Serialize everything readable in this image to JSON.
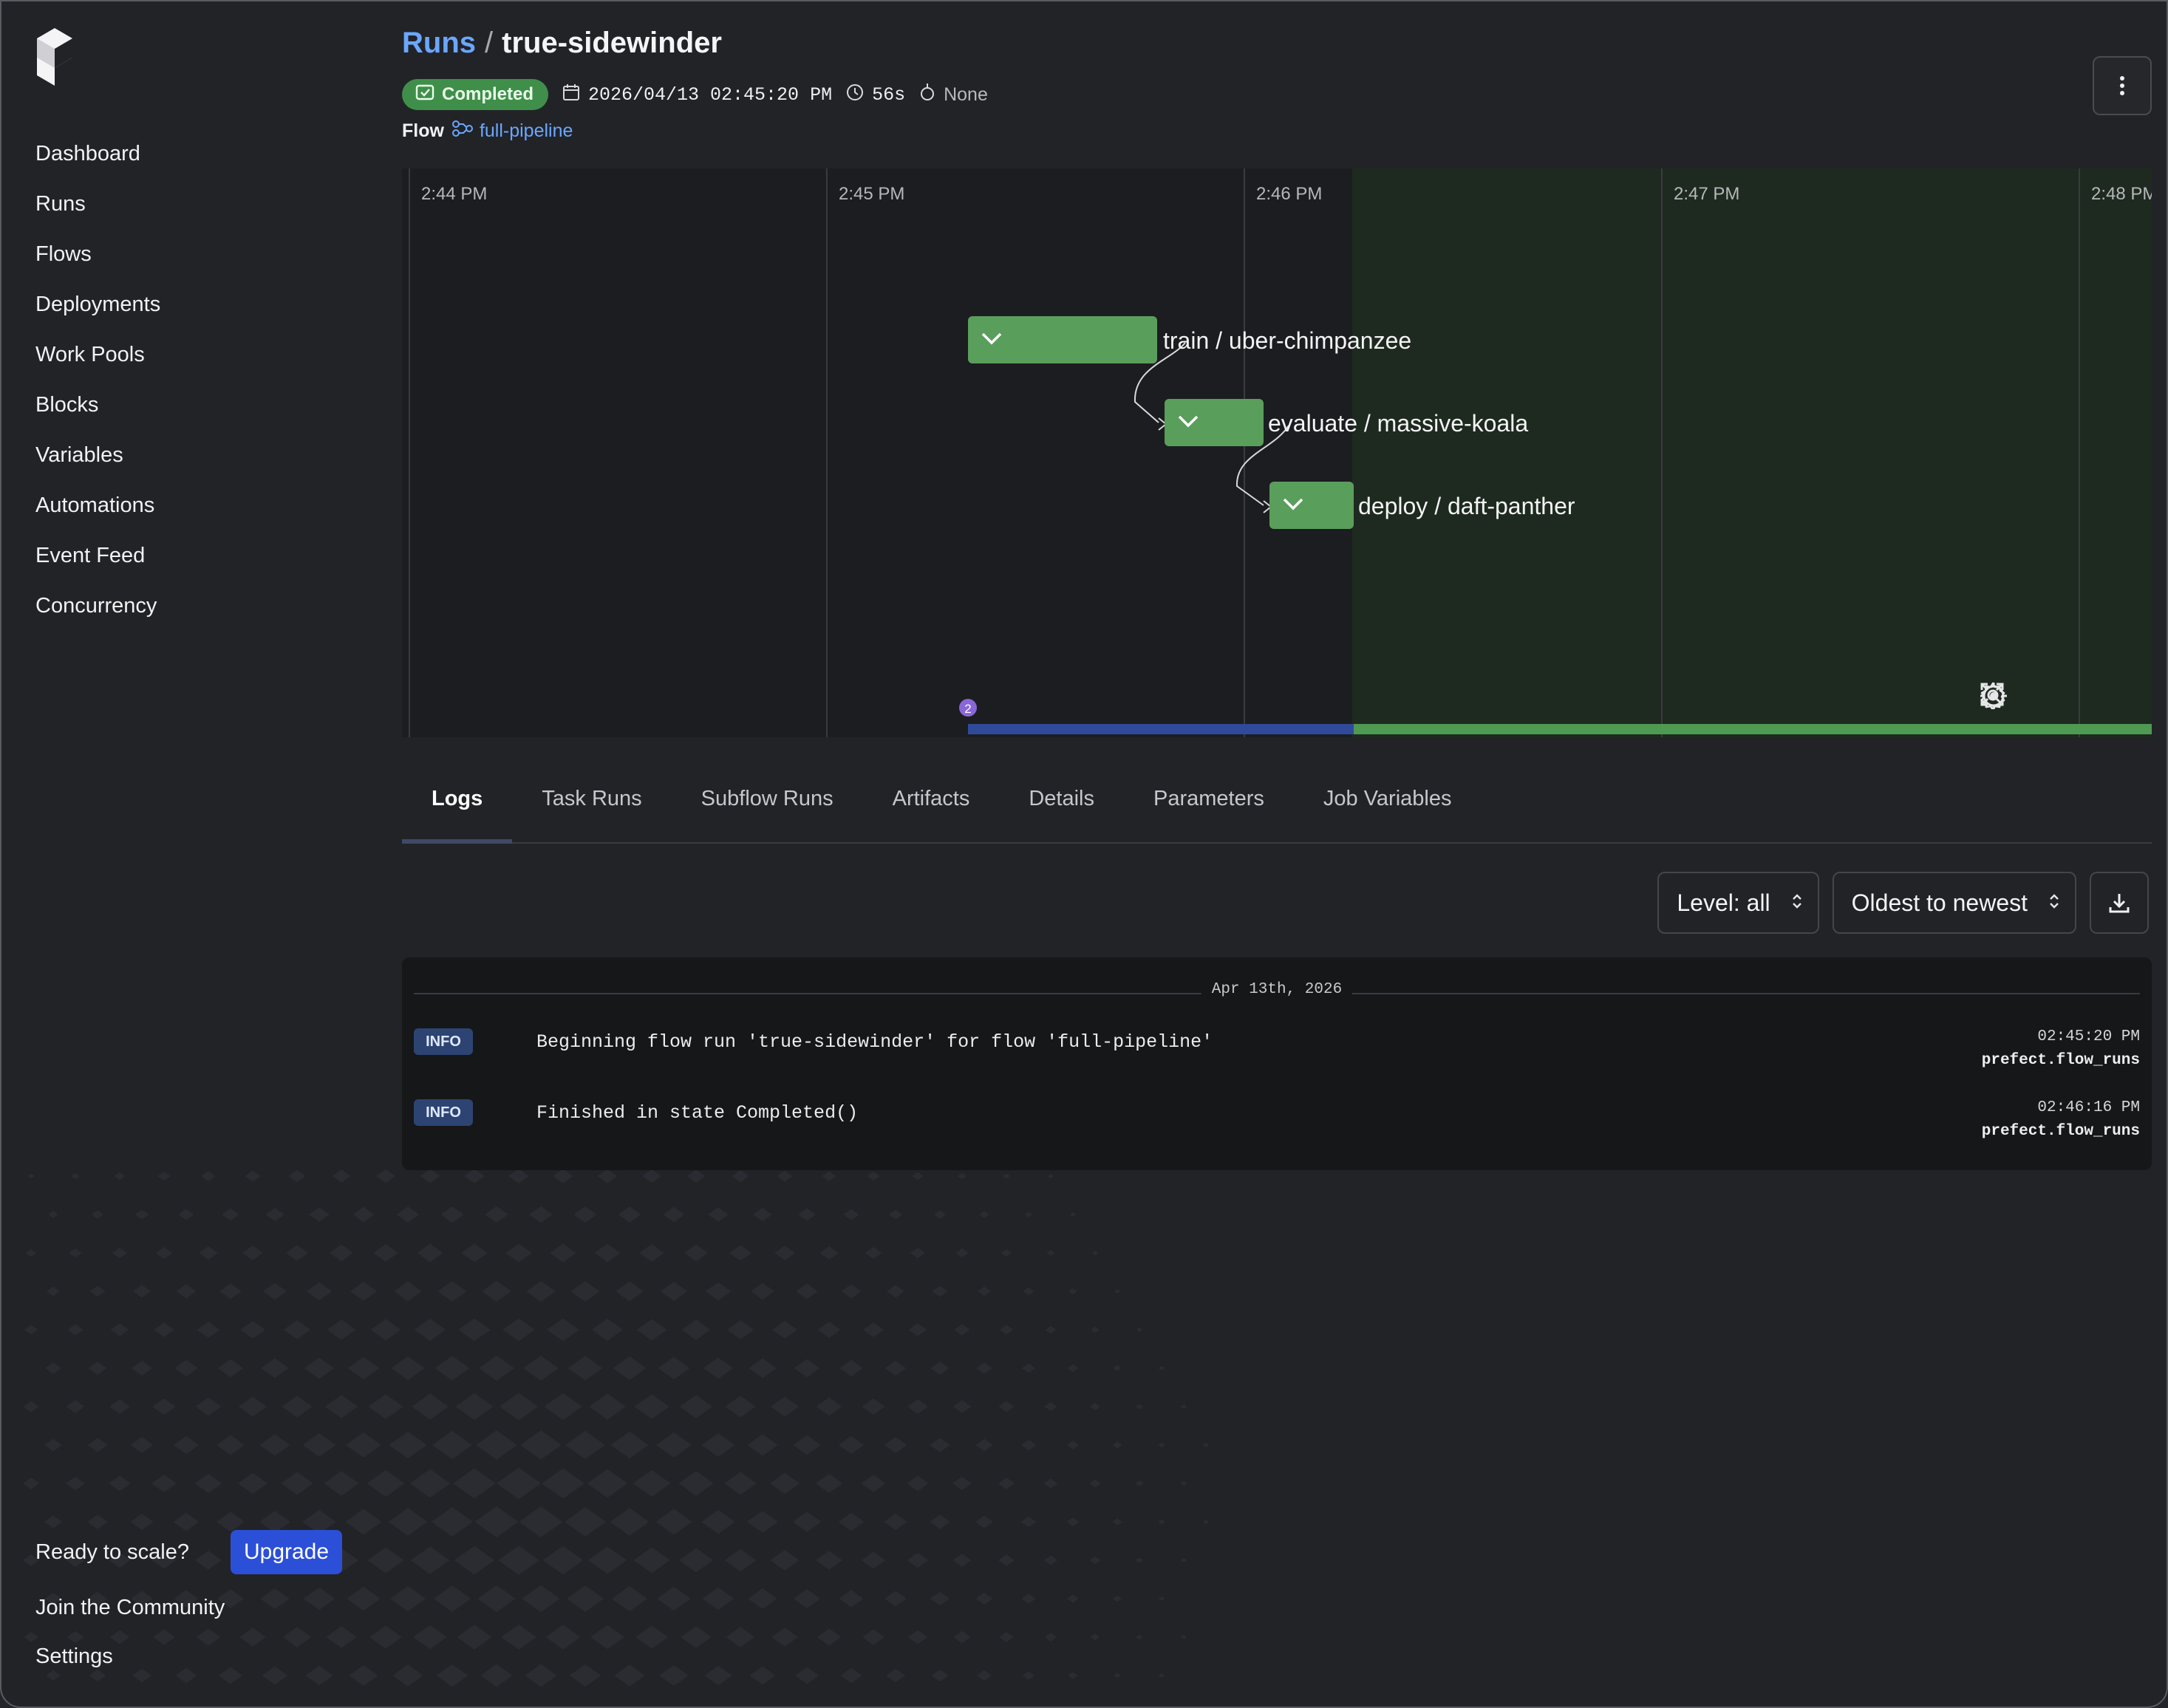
{
  "sidebar": {
    "nav": [
      {
        "label": "Dashboard"
      },
      {
        "label": "Runs"
      },
      {
        "label": "Flows"
      },
      {
        "label": "Deployments"
      },
      {
        "label": "Work Pools"
      },
      {
        "label": "Blocks"
      },
      {
        "label": "Variables"
      },
      {
        "label": "Automations"
      },
      {
        "label": "Event Feed"
      },
      {
        "label": "Concurrency"
      }
    ],
    "ready_text": "Ready to scale?",
    "upgrade_label": "Upgrade",
    "community_label": "Join the Community",
    "settings_label": "Settings"
  },
  "header": {
    "breadcrumb_runs": "Runs",
    "breadcrumb_sep": "/",
    "run_name": "true-sidewinder",
    "state": "Completed",
    "start_time": "2026/04/13 02:45:20 PM",
    "duration": "56s",
    "tag": "None",
    "flow_label": "Flow",
    "flow_name": "full-pipeline"
  },
  "timeline": {
    "ticks": [
      "2:44 PM",
      "2:45 PM",
      "2:46 PM",
      "2:47 PM",
      "2:48 PM"
    ],
    "tasks": [
      {
        "label": "train / uber-chimpanzee"
      },
      {
        "label": "evaluate / massive-koala"
      },
      {
        "label": "deploy / daft-panther"
      }
    ],
    "event_count": "2"
  },
  "tabs": [
    "Logs",
    "Task Runs",
    "Subflow Runs",
    "Artifacts",
    "Details",
    "Parameters",
    "Job Variables"
  ],
  "log_controls": {
    "level": "Level: all",
    "order": "Oldest to newest"
  },
  "logs": {
    "date": "Apr 13th, 2026",
    "entries": [
      {
        "level": "INFO",
        "message": "Beginning flow run 'true-sidewinder' for flow 'full-pipeline'",
        "time": "02:45:20 PM",
        "logger": "prefect.flow_runs"
      },
      {
        "level": "INFO",
        "message": "Finished in state Completed()",
        "time": "02:46:16 PM",
        "logger": "prefect.flow_runs"
      }
    ]
  },
  "colors": {
    "accent_link": "#6aa7ff",
    "completed": "#3f8f4a",
    "task_bar": "#5a9e5c",
    "upgrade": "#2c4fd8"
  }
}
